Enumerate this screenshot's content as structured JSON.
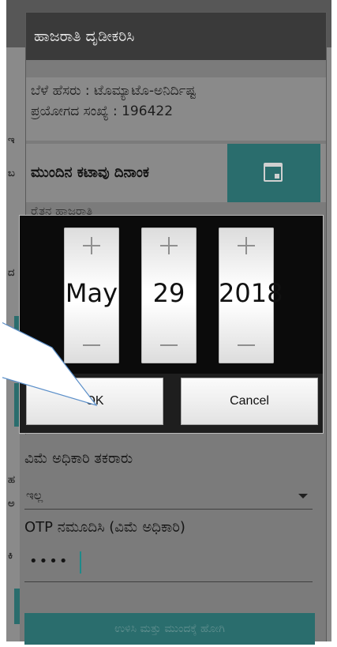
{
  "dialog": {
    "title": "ಹಾಜರಾತಿ ದೃಡೀಕರಿಸಿ",
    "crop_name": "ಬೆಳೆ ಹೆಸರು : ಟೊಮ್ಯಾಟೊ-ಅನಿರ್ದಿಷ್ಟ",
    "experiment_count": "ಪ್ರಯೋಗದ ಸಂಖ್ಯೆ : 196422",
    "next_harvest_label": "ಮುಂದಿನ ಕಟಾವು ದಿನಾಂಕ",
    "cut_label": "ರೈತನ ಹಾಜರಾತಿ",
    "icon": "calendar-icon"
  },
  "date_picker": {
    "month": "May",
    "day": "29",
    "year": "2018",
    "ok_label": "OK",
    "cancel_label": "Cancel"
  },
  "form": {
    "complaint_label": "ವಿಮೆ ಅಧಿಕಾರಿ ತಕರಾರು",
    "complaint_value": "ಇಲ್ಲ",
    "otp_label": "OTP ನಮೂದಿಸಿ (ವಿಮೆ ಅಧಿಕಾರಿ)",
    "otp_value": "••••",
    "submit_label": "ಉಳಿಸಿ ಮತ್ತು ಮುಂದಕ್ಕೆ ಹೋಗಿ"
  },
  "left_partial": {
    "t1": "ಇ",
    "t2": "ಬ",
    "t3": "ದ",
    "t4": "ಹ",
    "t5": "ಅ",
    "t6": "ಕಿ"
  },
  "colors": {
    "teal": "#2a6d6d",
    "callout_fill": "#ffffff",
    "callout_stroke": "#5b8fc9"
  }
}
